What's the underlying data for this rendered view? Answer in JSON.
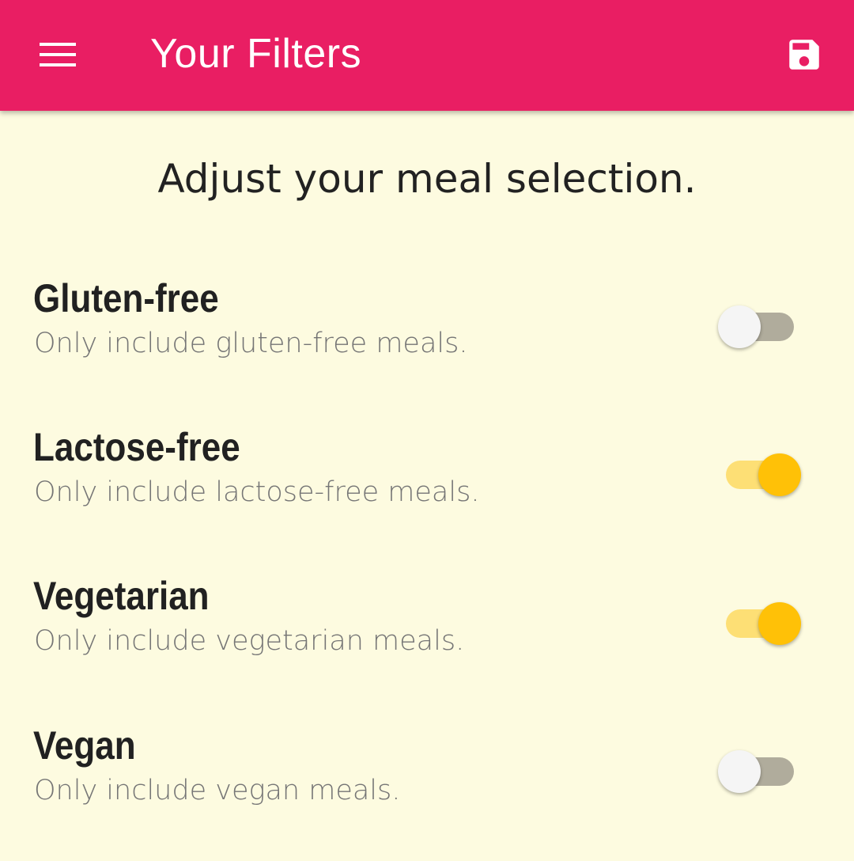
{
  "app_bar": {
    "title": "Your Filters",
    "menu_icon": "hamburger-menu-icon",
    "save_icon": "save-floppy-icon",
    "background_color": "#e91e63"
  },
  "main": {
    "heading": "Adjust your meal selection.",
    "background_color": "#fdfbe0",
    "accent_color": "#ffc107"
  },
  "filters": [
    {
      "title": "Gluten-free",
      "subtitle": "Only include gluten-free meals.",
      "enabled": false
    },
    {
      "title": "Lactose-free",
      "subtitle": "Only include lactose-free meals.",
      "enabled": true
    },
    {
      "title": "Vegetarian",
      "subtitle": "Only include vegetarian meals.",
      "enabled": true
    },
    {
      "title": "Vegan",
      "subtitle": "Only include vegan meals.",
      "enabled": false
    }
  ]
}
